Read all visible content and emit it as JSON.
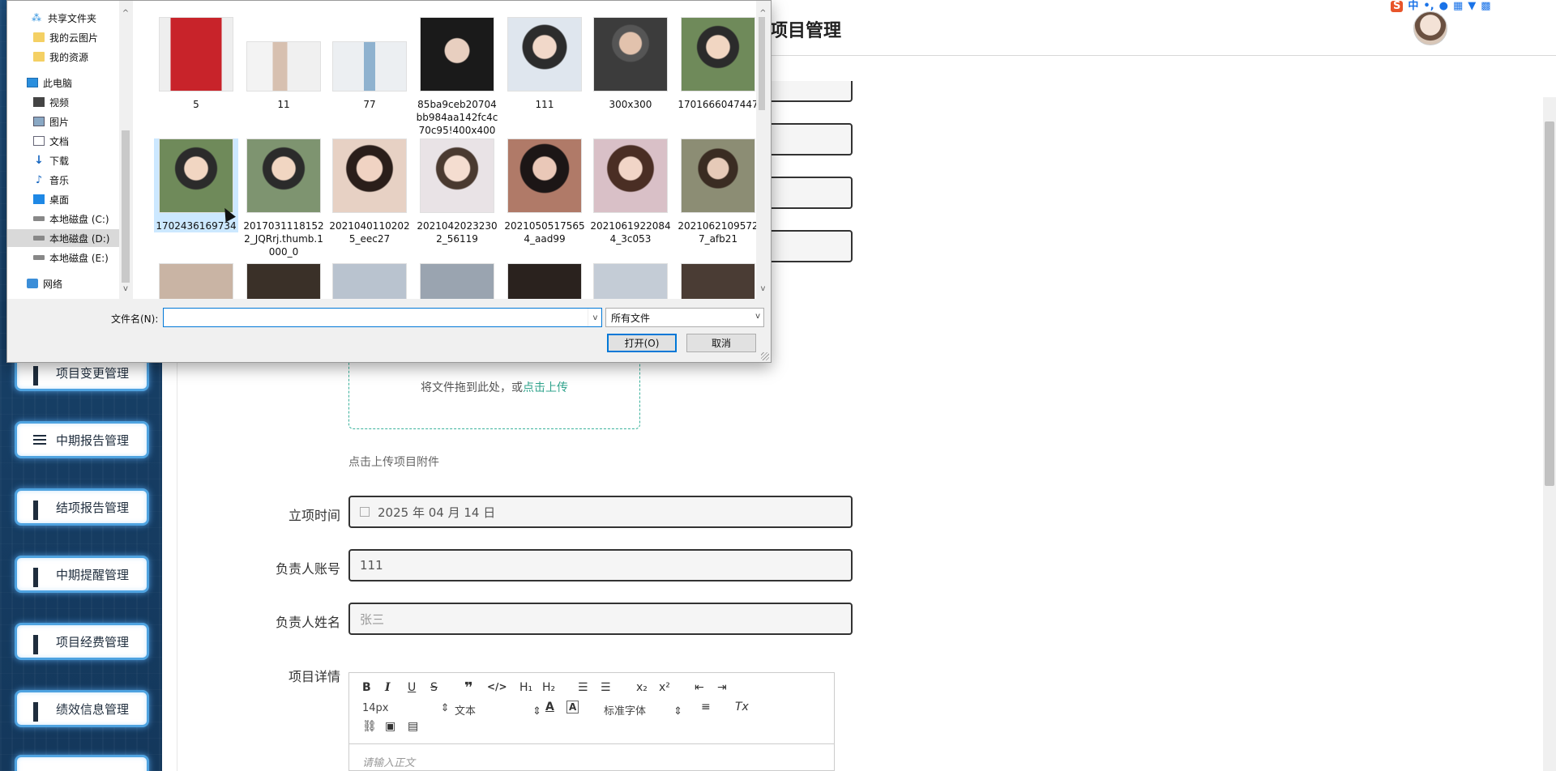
{
  "app": {
    "page_title": "项目管理",
    "sidebar_items": [
      {
        "label": "项目变更管理",
        "icon": "grid-icon"
      },
      {
        "label": "中期报告管理",
        "icon": "sliders-icon"
      },
      {
        "label": "结项报告管理",
        "icon": "grid-icon"
      },
      {
        "label": "中期提醒管理",
        "icon": "grid-icon"
      },
      {
        "label": "项目经费管理",
        "icon": "grid-icon"
      },
      {
        "label": "绩效信息管理",
        "icon": "grid-icon"
      }
    ],
    "upload": {
      "drop_text": "将文件拖到此处，或",
      "link_text": "点击上传",
      "hint": "点击上传项目附件"
    },
    "form": {
      "date_label": "立项时间",
      "date_value": "2025 年 04 月 14 日",
      "account_label": "负责人账号",
      "account_value": "111",
      "name_label": "负责人姓名",
      "name_placeholder": "张三",
      "detail_label": "项目详情"
    },
    "editor": {
      "font_size": "14px",
      "block_format": "文本",
      "font_family": "标准字体",
      "placeholder": "请输入正文"
    },
    "tray_icons": [
      "sogou-icon",
      "ime-zh-icon",
      "punctuation-icon",
      "mic-icon",
      "keyboard-icon",
      "shirt-icon",
      "apps-icon"
    ]
  },
  "dialog": {
    "nav_items": [
      {
        "label": "共享文件夹",
        "icon": "share-icon"
      },
      {
        "label": "我的云图片",
        "icon": "folder-icon"
      },
      {
        "label": "我的资源",
        "icon": "folder-icon"
      },
      {
        "label": "此电脑",
        "icon": "pc-icon"
      },
      {
        "label": "视频",
        "icon": "video-icon"
      },
      {
        "label": "图片",
        "icon": "pictures-icon"
      },
      {
        "label": "文档",
        "icon": "documents-icon"
      },
      {
        "label": "下载",
        "icon": "download-icon"
      },
      {
        "label": "音乐",
        "icon": "music-icon"
      },
      {
        "label": "桌面",
        "icon": "desktop-icon"
      },
      {
        "label": "本地磁盘 (C:)",
        "icon": "drive-icon"
      },
      {
        "label": "本地磁盘 (D:)",
        "icon": "drive-icon"
      },
      {
        "label": "本地磁盘 (E:)",
        "icon": "drive-icon"
      },
      {
        "label": "网络",
        "icon": "network-icon"
      }
    ],
    "files_row1": [
      "5",
      "11",
      "77",
      "85ba9ceb20704bb984aa142fc4c70c95!400x400",
      "111",
      "300x300",
      "1701666047447"
    ],
    "files_row2": [
      "1702436169734",
      "20170311181522_JQRrj.thumb.1000_0",
      "20210401102025_eec27",
      "20210420232302_56119",
      "20210505175654_aad99",
      "20210619220844_3c053",
      "20210621095727_afb21"
    ],
    "filename_label": "文件名(N):",
    "filename_value": "",
    "filetype_value": "所有文件",
    "open_label": "打开(O)",
    "cancel_label": "取消"
  }
}
